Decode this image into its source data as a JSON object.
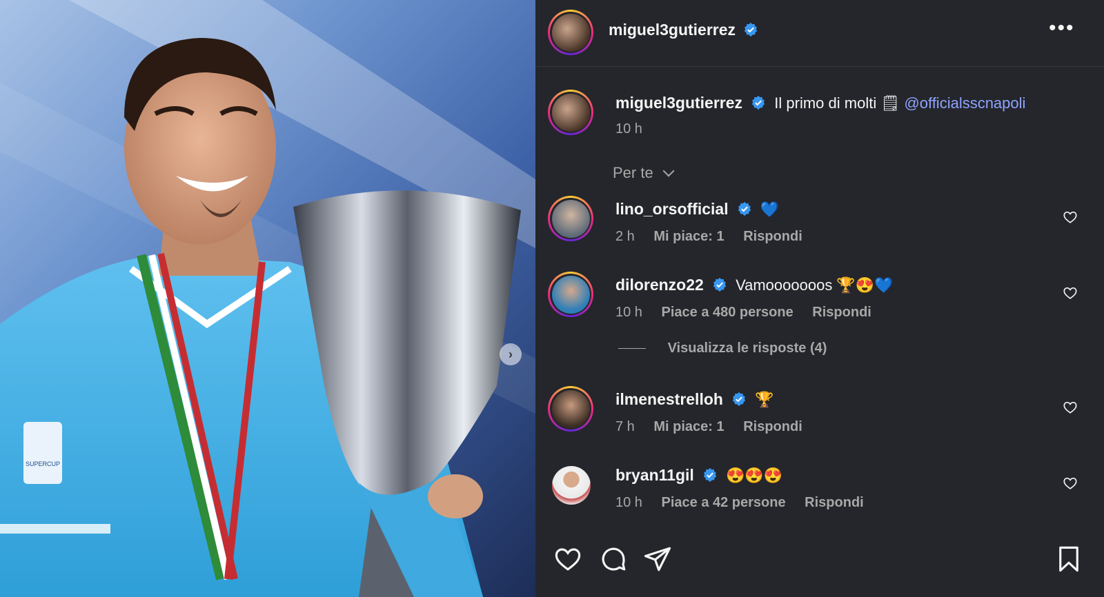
{
  "post": {
    "username": "miguel3gutierrez",
    "more_icon": "more-horizontal-icon"
  },
  "caption": {
    "username": "miguel3gutierrez",
    "text": "Il primo di molti",
    "emoji": "🗒",
    "mention": "@officialsscnapoli",
    "time": "10 h"
  },
  "sort": {
    "label": "Per te"
  },
  "comments": [
    {
      "username": "lino_orsofficial",
      "text": "💙",
      "time": "2 h",
      "likes": "Mi piace: 1",
      "reply": "Rispondi"
    },
    {
      "username": "dilorenzo22",
      "text": "Vamooooooos 🏆😍💙",
      "time": "10 h",
      "likes": "Piace a 480 persone",
      "reply": "Rispondi"
    },
    {
      "username": "ilmenestrelloh",
      "text": "🏆",
      "time": "7 h",
      "likes": "Mi piace: 1",
      "reply": "Rispondi"
    },
    {
      "username": "bryan11gil",
      "text": "😍😍😍",
      "time": "10 h",
      "likes": "Piace a 42 persone",
      "reply": "Rispondi"
    }
  ],
  "view_replies": "Visualizza le risposte (4)",
  "colors": {
    "panel_bg": "#24262b",
    "verified": "#3897f0",
    "mention": "#8ea3ff",
    "muted": "#a8a8a8"
  }
}
